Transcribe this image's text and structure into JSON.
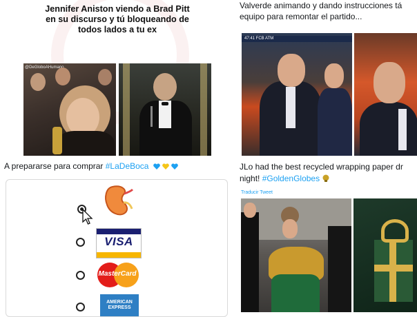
{
  "meme": {
    "caption": "Jennifer Aniston viendo a Brad Pitt\nen su discurso y tú bloqueando de\ntodos lados a tu ex",
    "watermark": "@DeGloboAHumano"
  },
  "tweet_left": {
    "text": "A prepararse para comprar ",
    "hashtag": "#LaDeBoca",
    "emoji_colors": [
      "#1da1f2",
      "#f5c518",
      "#1da1f2"
    ]
  },
  "poll": {
    "options": [
      {
        "name": "kidney",
        "selected": true
      },
      {
        "name": "visa",
        "selected": false,
        "label": "VISA"
      },
      {
        "name": "mastercard",
        "selected": false,
        "label": "MasterCard"
      },
      {
        "name": "american-express",
        "selected": false,
        "label": "AMERICAN\nEXPRESS"
      }
    ]
  },
  "tweet_right_top": {
    "line1": "Valverde animando y dando instrucciones tá",
    "line2": "equipo para remontar el partido..."
  },
  "gallery1": {
    "scoreboard": "47:41  FCB  ATM"
  },
  "tweet_right_bottom": {
    "line1": "JLo had the best recycled wrapping paper dr",
    "line2_prefix": "night! ",
    "hashtag": "#GoldenGlobes"
  },
  "translate_label": "Traducir Tweet",
  "colors": {
    "link": "#1da1f2",
    "text": "#14171a",
    "visa_blue": "#1a1f71",
    "visa_gold": "#f7b600",
    "mc_red": "#e31d1a",
    "mc_orange": "#f7a11a",
    "amex_blue": "#2e7fc4"
  }
}
